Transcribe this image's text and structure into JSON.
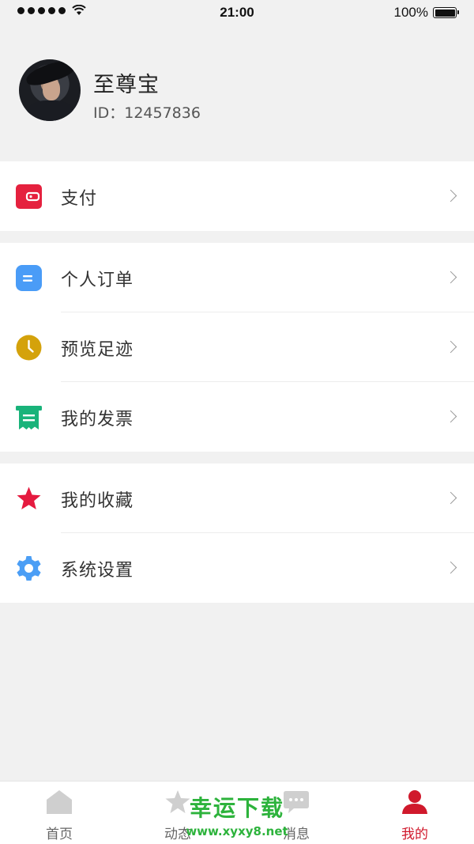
{
  "status_bar": {
    "time": "21:00",
    "battery_text": "100%",
    "battery_level": 1.0,
    "signal_bars": 5,
    "icons": [
      "signal-dots-icon",
      "wifi-icon",
      "battery-icon"
    ]
  },
  "profile": {
    "name": "至尊宝",
    "id_text": "ID：12457836"
  },
  "menu_groups": [
    {
      "items": [
        {
          "label": "支付",
          "icon": "wallet-icon",
          "color": "#e5213e"
        }
      ]
    },
    {
      "items": [
        {
          "label": "个人订单",
          "icon": "order-list-icon",
          "color": "#4a9cf7"
        },
        {
          "label": "预览足迹",
          "icon": "clock-icon",
          "color": "#d4a20b"
        },
        {
          "label": "我的发票",
          "icon": "receipt-icon",
          "color": "#19b37a"
        }
      ]
    },
    {
      "items": [
        {
          "label": "我的收藏",
          "icon": "star-icon",
          "color": "#e51a3f"
        },
        {
          "label": "系统设置",
          "icon": "gear-icon",
          "color": "#4b9ef5"
        }
      ]
    }
  ],
  "tab_bar": {
    "tabs": [
      {
        "label": "首页",
        "icon": "home-icon",
        "active": false
      },
      {
        "label": "动态",
        "icon": "star-outline-icon",
        "active": false
      },
      {
        "label": "消息",
        "icon": "message-icon",
        "active": false
      },
      {
        "label": "我的",
        "icon": "person-icon",
        "active": true
      }
    ],
    "active_color": "#d0192c",
    "inactive_color": "#cfcfcf"
  },
  "watermark": {
    "title": "幸运下载",
    "url": "www.xyxy8.net"
  }
}
